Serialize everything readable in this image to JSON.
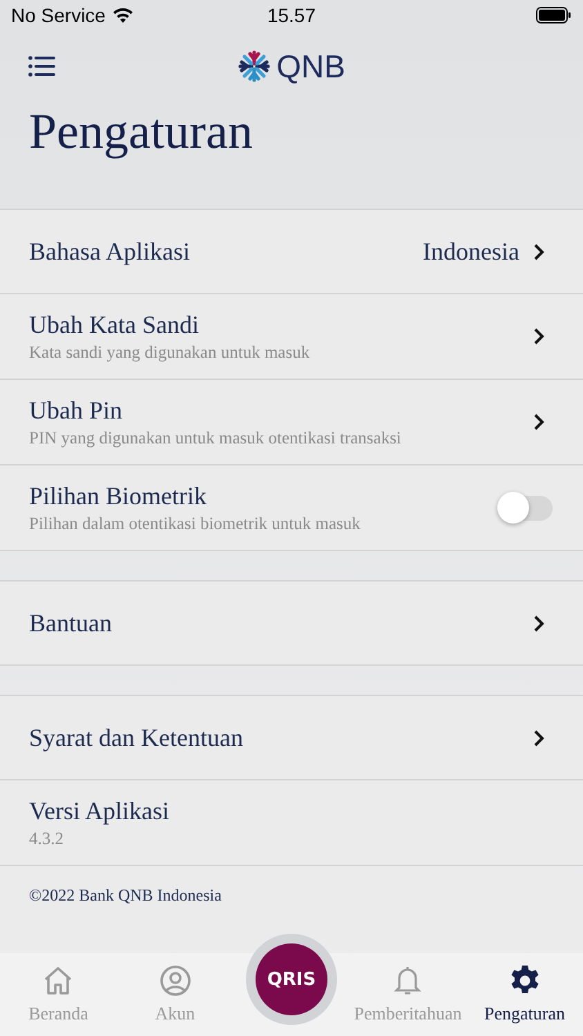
{
  "status_bar": {
    "carrier": "No Service",
    "time": "15.57"
  },
  "header": {
    "logo": "QNB"
  },
  "title": "Pengaturan",
  "sections": [
    [
      {
        "kind": "link",
        "label": "Bahasa Aplikasi",
        "value": "Indonesia"
      },
      {
        "kind": "link",
        "label": "Ubah Kata Sandi",
        "description": "Kata sandi yang digunakan untuk masuk"
      },
      {
        "kind": "link",
        "label": "Ubah Pin",
        "description": "PIN yang digunakan untuk masuk otentikasi transaksi"
      },
      {
        "kind": "toggle",
        "label": "Pilihan Biometrik",
        "description": "Pilihan dalam otentikasi biometrik untuk masuk",
        "on": false
      }
    ],
    [
      {
        "kind": "link",
        "label": "Bantuan"
      }
    ],
    [
      {
        "kind": "link",
        "label": "Syarat dan Ketentuan"
      },
      {
        "kind": "info",
        "label": "Versi Aplikasi",
        "description": "4.3.2"
      }
    ]
  ],
  "copyright": "©2022 Bank QNB Indonesia",
  "tab_bar": {
    "center": "QRIS",
    "tabs": [
      {
        "kind": "home",
        "label": "Beranda",
        "selected": false
      },
      {
        "kind": "account",
        "label": "Akun",
        "selected": false
      },
      {
        "kind": "bell",
        "label": "Pemberitahuan",
        "selected": false
      },
      {
        "kind": "gear",
        "label": "Pengaturan",
        "selected": true
      }
    ]
  }
}
